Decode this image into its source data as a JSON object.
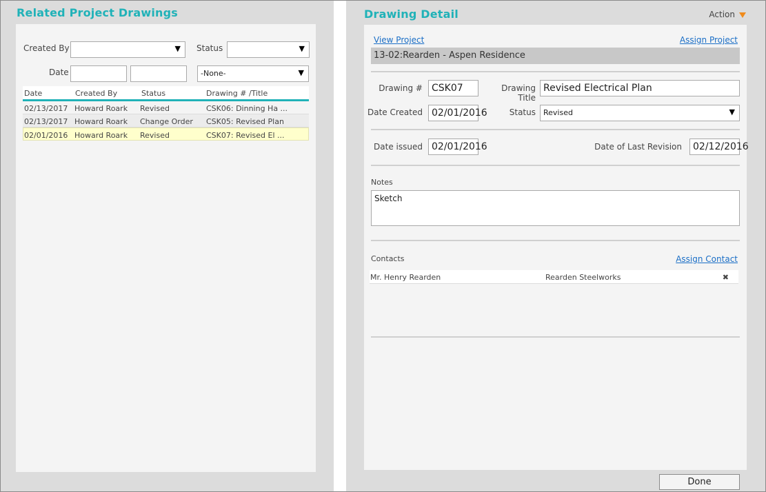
{
  "left": {
    "title": "Related Project Drawings",
    "filters": {
      "created_by_label": "Created By",
      "created_by_value": "",
      "status_label": "Status",
      "status_value": "",
      "date_label": "Date",
      "date_from": "",
      "date_to": "",
      "date_range_value": "-None-"
    },
    "table": {
      "headers": [
        "Date",
        "Created By",
        "Status",
        "Drawing # /Title"
      ],
      "rows": [
        {
          "date": "02/13/2017",
          "created_by": "Howard Roark",
          "status": "Revised",
          "drawing": "CSK06: Dinning Ha ..."
        },
        {
          "date": "02/13/2017",
          "created_by": "Howard Roark",
          "status": "Change Order",
          "drawing": "CSK05: Revised Plan"
        },
        {
          "date": "02/01/2016",
          "created_by": "Howard Roark",
          "status": "Revised",
          "drawing": "CSK07: Revised El ..."
        }
      ]
    }
  },
  "right": {
    "title": "Drawing Detail",
    "action_label": "Action",
    "view_project_label": "View Project",
    "assign_project_label": "Assign Project",
    "project_name": "13-02:Rearden - Aspen Residence",
    "drawing_num_label": "Drawing #",
    "drawing_num_value": "CSK07",
    "drawing_title_label": "Drawing Title",
    "drawing_title_value": "Revised Electrical Plan",
    "date_created_label": "Date Created",
    "date_created_value": "02/01/2016",
    "status_label": "Status",
    "status_value": "Revised",
    "date_issued_label": "Date issued",
    "date_issued_value": "02/01/2016",
    "last_revision_label": "Date of Last Revision",
    "last_revision_value": "02/12/2016",
    "notes_label": "Notes",
    "notes_value": "Sketch",
    "contacts_label": "Contacts",
    "assign_contact_label": "Assign Contact",
    "contacts": [
      {
        "name": "Mr. Henry Rearden",
        "company": "Rearden Steelworks"
      }
    ],
    "done_label": "Done"
  },
  "icons": {
    "dropdown": "dropdown-arrow-icon",
    "action": "triangle-down-icon",
    "remove": "remove-x-icon"
  },
  "colors": {
    "accent": "#20b2b8",
    "link": "#1a6ec6",
    "selected_row": "#ffffcc",
    "action_arrow": "#f08b1c",
    "remove": "#e07070"
  }
}
